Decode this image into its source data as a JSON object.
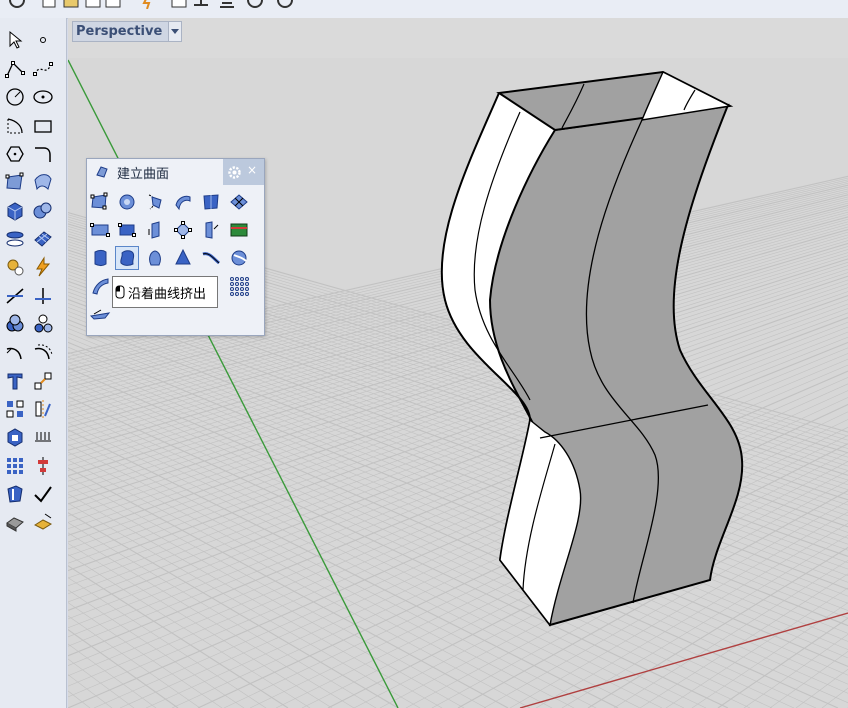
{
  "viewport": {
    "title": "Perspective",
    "menu_icon": "triangle-down-icon",
    "background": "#d7d7d7",
    "grid_color": "#c2c2c2",
    "x_axis_color": "#b04040",
    "y_axis_color": "#3a9a3a"
  },
  "toolbar_icons": [
    "history-icon",
    "new-file-icon",
    "open-icon",
    "save-icon",
    "print-icon",
    "lightning-icon",
    "cut-icon",
    "copy-icon",
    "paste-icon",
    "undo-icon"
  ],
  "sidebar_tools": [
    "select-arrow-icon",
    "point-icon",
    "polyline-icon",
    "curve-from-points-icon",
    "circle-icon",
    "ellipse-icon",
    "arc-icon",
    "rectangle-icon",
    "polygon-icon",
    "fillet-curve-icon",
    "surface-from-points-icon",
    "surface-patch-icon",
    "box-solid-icon",
    "sphere-icon",
    "cylinder-icon",
    "mesh-icon",
    "gear-transform-icon",
    "lightning-icon",
    "trim-icon",
    "split-icon",
    "boolean-union-icon",
    "explode-icon",
    "fillet-edge-icon",
    "offset-curve-icon",
    "text-icon",
    "scale-icon",
    "array-icon",
    "mirror-icon",
    "cage-edit-icon",
    "dimension-icon",
    "grid-array-icon",
    "align-icon",
    "shell-icon",
    "check-mark-icon",
    "render-icon",
    "material-icon"
  ],
  "panel": {
    "title": "建立曲面",
    "tab_icon": "surface-tab-icon",
    "gear_icon": "gear-icon",
    "close_icon": "close-icon",
    "close_label": "×",
    "buttons": [
      "surface-from-corners-icon",
      "sphere-surface-icon",
      "sweep-1-rail-icon",
      "loft-icon",
      "planar-surface-icon",
      "network-surface-icon",
      "surface-from-curves-icon",
      "rectangle-plane-icon",
      "extrude-curve-icon",
      "edge-surface-icon",
      "split-surface-icon",
      "patch-icon",
      "extrude-surface-icon",
      "extrude-along-curve-icon",
      "revolve-icon",
      "cone-icon",
      "rail-revolve-icon",
      "drape-icon",
      "blend-surface-icon",
      "point-grid-icon",
      "boat-surface-icon"
    ],
    "active_button": "extrude-along-curve-icon"
  },
  "tooltip": {
    "icon": "mouse-left-icon",
    "text": "沿着曲线挤出"
  },
  "model": {
    "face_dark": "#a1a1a1",
    "face_light": "#ffffff",
    "edge_color": "#000000"
  }
}
